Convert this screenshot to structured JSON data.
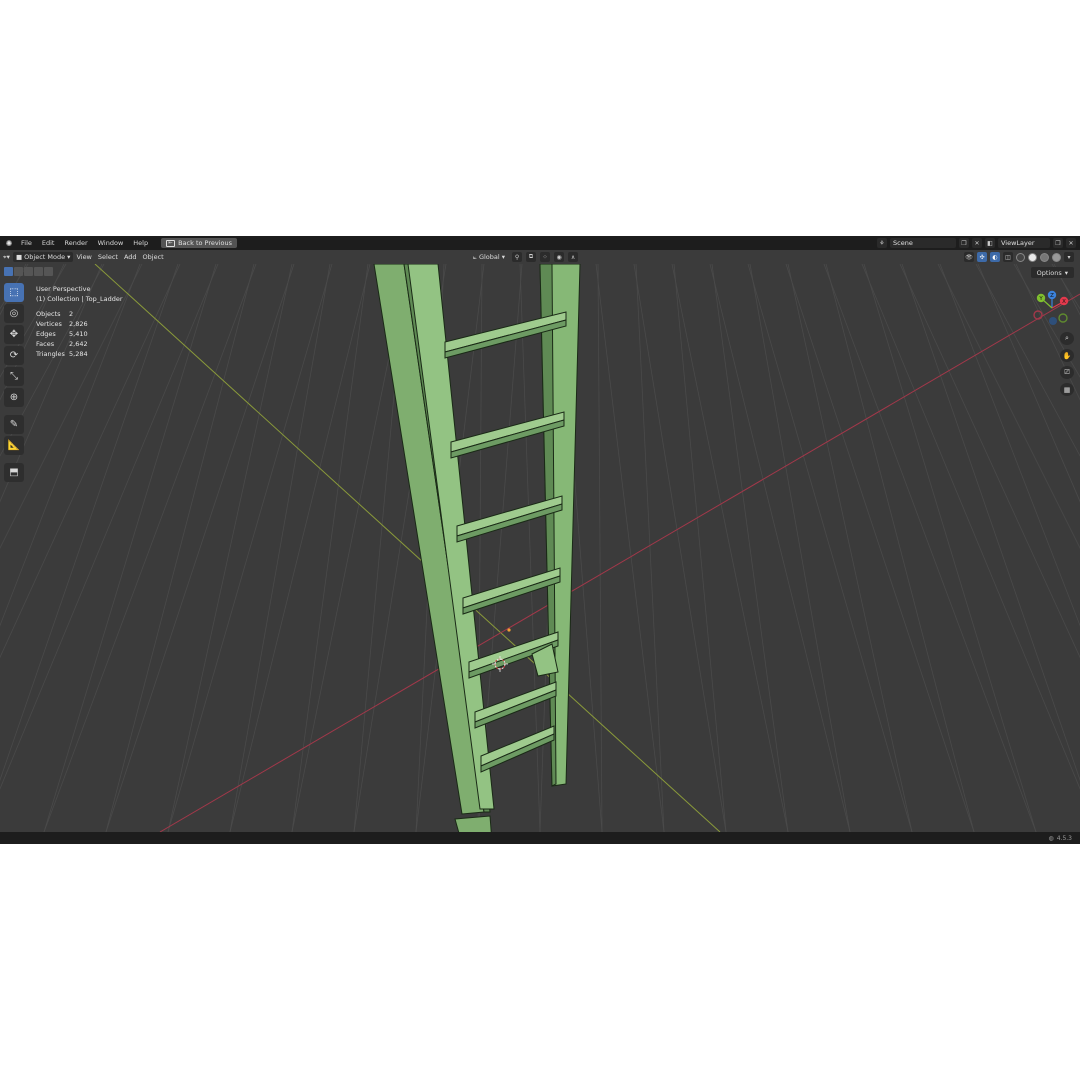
{
  "topbar": {
    "menus": [
      "File",
      "Edit",
      "Render",
      "Window",
      "Help"
    ],
    "back_label": "Back to Previous",
    "scene_name": "Scene",
    "view_layer": "ViewLayer"
  },
  "viewport_header": {
    "mode": "Object Mode",
    "menus": [
      "View",
      "Select",
      "Add",
      "Object"
    ],
    "orientation": "Global",
    "options_label": "Options"
  },
  "overlay": {
    "perspective": "User Perspective",
    "collection": "(1) Collection | Top_Ladder",
    "stats": [
      {
        "label": "Objects",
        "value": "2"
      },
      {
        "label": "Vertices",
        "value": "2,826"
      },
      {
        "label": "Edges",
        "value": "5,410"
      },
      {
        "label": "Faces",
        "value": "2,642"
      },
      {
        "label": "Triangles",
        "value": "5,284"
      }
    ]
  },
  "gizmo": {
    "x": "X",
    "y": "Y",
    "z": "Z",
    "colors": {
      "x": "#e3394c",
      "y": "#7fbf2f",
      "z": "#3b82db"
    }
  },
  "status": {
    "version": "4.5.3"
  },
  "colors": {
    "ladder": "#8fbf7f",
    "ladder_dark": "#6d9b63",
    "viewport_bg": "#3b3b3b",
    "accent": "#4772b3"
  }
}
